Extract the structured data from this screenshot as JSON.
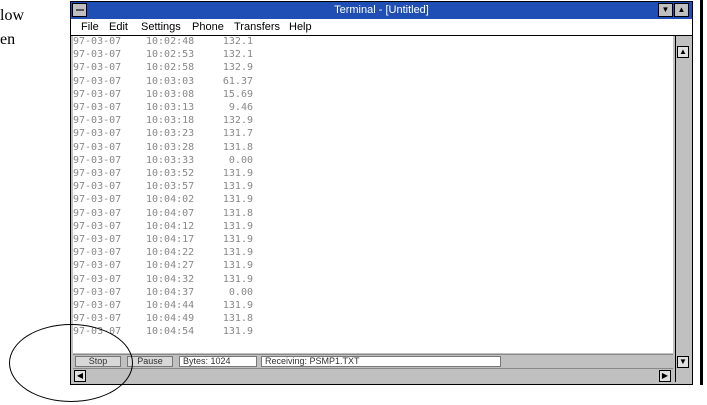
{
  "doc": {
    "line1": "low",
    "line2": "en"
  },
  "window": {
    "title": "Terminal - [Untitled]"
  },
  "menu": [
    "File",
    "Edit",
    "Settings",
    "Phone",
    "Transfers",
    "Help"
  ],
  "rows": [
    {
      "date": "97-03-07",
      "time": "10:02:48",
      "value": "132.1"
    },
    {
      "date": "97-03-07",
      "time": "10:02:53",
      "value": "132.1"
    },
    {
      "date": "97-03-07",
      "time": "10:02:58",
      "value": "132.9"
    },
    {
      "date": "97-03-07",
      "time": "10:03:03",
      "value": "61.37"
    },
    {
      "date": "97-03-07",
      "time": "10:03:08",
      "value": "15.69"
    },
    {
      "date": "97-03-07",
      "time": "10:03:13",
      "value": "9.46"
    },
    {
      "date": "97-03-07",
      "time": "10:03:18",
      "value": "132.9"
    },
    {
      "date": "97-03-07",
      "time": "10:03:23",
      "value": "131.7"
    },
    {
      "date": "97-03-07",
      "time": "10:03:28",
      "value": "131.8"
    },
    {
      "date": "97-03-07",
      "time": "10:03:33",
      "value": "0.00"
    },
    {
      "date": "97-03-07",
      "time": "10:03:52",
      "value": "131.9"
    },
    {
      "date": "97-03-07",
      "time": "10:03:57",
      "value": "131.9"
    },
    {
      "date": "97-03-07",
      "time": "10:04:02",
      "value": "131.9"
    },
    {
      "date": "97-03-07",
      "time": "10:04:07",
      "value": "131.8"
    },
    {
      "date": "97-03-07",
      "time": "10:04:12",
      "value": "131.9"
    },
    {
      "date": "97-03-07",
      "time": "10:04:17",
      "value": "131.9"
    },
    {
      "date": "97-03-07",
      "time": "10:04:22",
      "value": "131.9"
    },
    {
      "date": "97-03-07",
      "time": "10:04:27",
      "value": "131.9"
    },
    {
      "date": "97-03-07",
      "time": "10:04:32",
      "value": "131.9"
    },
    {
      "date": "97-03-07",
      "time": "10:04:37",
      "value": "0.00"
    },
    {
      "date": "97-03-07",
      "time": "10:04:44",
      "value": "131.9"
    },
    {
      "date": "97-03-07",
      "time": "10:04:49",
      "value": "131.8"
    },
    {
      "date": "97-03-07",
      "time": "10:04:54",
      "value": "131.9"
    }
  ],
  "status": {
    "stop": "Stop",
    "pause": "Pause",
    "bytes": "Bytes: 1024",
    "receiving": "Receiving: PSMP1.TXT"
  },
  "icons": {
    "sysmenu": "system-menu-icon",
    "minimize": "minimize-icon",
    "maximize": "maximize-icon",
    "scroll_up": "arrow-up-icon",
    "scroll_down": "arrow-down-icon",
    "scroll_left": "arrow-left-icon",
    "scroll_right": "arrow-right-icon"
  },
  "colors": {
    "titlebar": "#1f4fb4",
    "chrome": "#c0c0c0",
    "terminal_text": "#888888"
  }
}
